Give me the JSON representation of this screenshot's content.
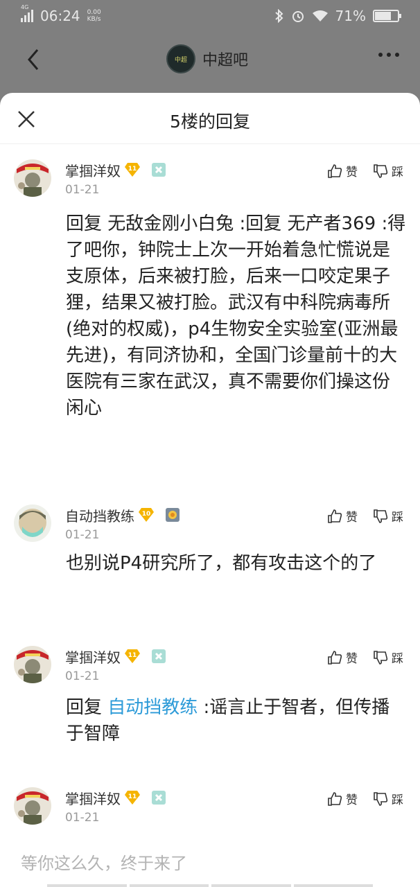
{
  "status_bar": {
    "network": "4G",
    "time": "06:24",
    "speed_value": "0.00",
    "speed_unit": "KB/s",
    "battery": "71%",
    "battery_level": 0.71
  },
  "header": {
    "forum_name": "中超吧",
    "forum_avatar_text": "中超"
  },
  "sheet": {
    "title": "5楼的回复"
  },
  "replies": [
    {
      "username": "掌掴洋奴",
      "level": "11",
      "date": "01-21",
      "like_label": "赞",
      "dislike_label": "踩",
      "text": "回复 无敌金刚小白兔 :回复 无产者369 :得了吧你，钟院士上次一开始着急忙慌说是支原体，后来被打脸，后来一口咬定果子狸，结果又被打脸。武汉有中科院病毒所(绝对的权威)，p4生物安全实验室(亚洲最先进)，有同济协和，全国门诊量前十的大医院有三家在武汉，真不需要你们操这份闲心"
    },
    {
      "username": "自动挡教练",
      "level": "10",
      "date": "01-21",
      "like_label": "赞",
      "dislike_label": "踩",
      "text": "也别说P4研究所了，都有攻击这个的了"
    },
    {
      "username": "掌掴洋奴",
      "level": "11",
      "date": "01-21",
      "like_label": "赞",
      "dislike_label": "踩",
      "prefix": "回复 ",
      "mention": "自动挡教练",
      "text": " :谣言止于智者，但传播于智障"
    },
    {
      "username": "掌掴洋奴",
      "level": "11",
      "date": "01-21",
      "like_label": "赞",
      "dislike_label": "踩"
    }
  ],
  "input": {
    "placeholder": "等你这么久，终于来了"
  },
  "colors": {
    "mention": "#2d9bd8",
    "overlay": "#7f7f7f",
    "badge": "#f5b400"
  }
}
